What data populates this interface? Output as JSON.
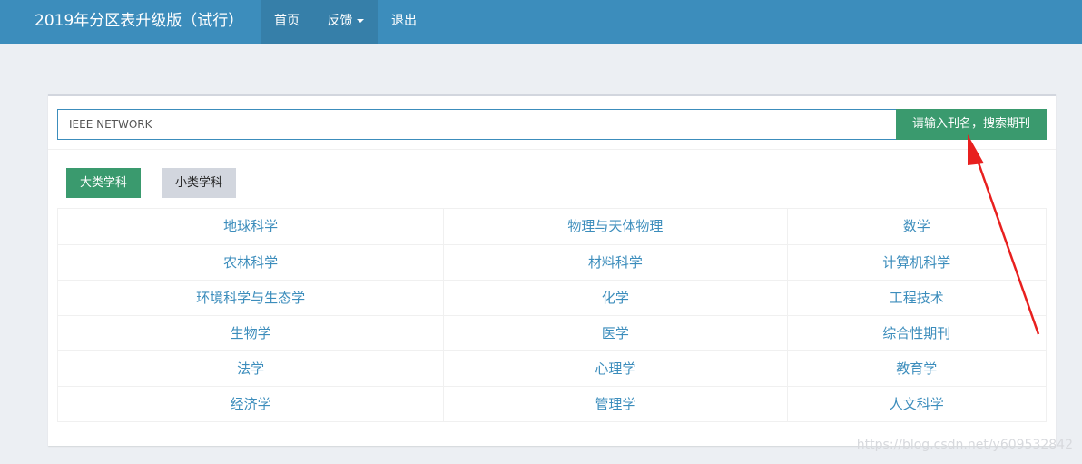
{
  "navbar": {
    "brand": "2019年分区表升级版（试行）",
    "items": [
      {
        "label": "首页"
      },
      {
        "label": "反馈"
      },
      {
        "label": "退出"
      }
    ]
  },
  "search": {
    "value": "IEEE NETWORK",
    "button_label": "请输入刊名，搜索期刊"
  },
  "tabs": [
    {
      "label": "大类学科"
    },
    {
      "label": "小类学科"
    }
  ],
  "subjects": [
    [
      "地球科学",
      "物理与天体物理",
      "数学"
    ],
    [
      "农林科学",
      "材料科学",
      "计算机科学"
    ],
    [
      "环境科学与生态学",
      "化学",
      "工程技术"
    ],
    [
      "生物学",
      "医学",
      "综合性期刊"
    ],
    [
      "法学",
      "心理学",
      "教育学"
    ],
    [
      "经济学",
      "管理学",
      "人文科学"
    ]
  ],
  "watermark": "https://blog.csdn.net/y609532842",
  "colors": {
    "navbar": "#3c8dbc",
    "accent_green": "#3a9a6e",
    "link_blue": "#3c8dbc",
    "annotation_arrow": "#e8201f"
  }
}
